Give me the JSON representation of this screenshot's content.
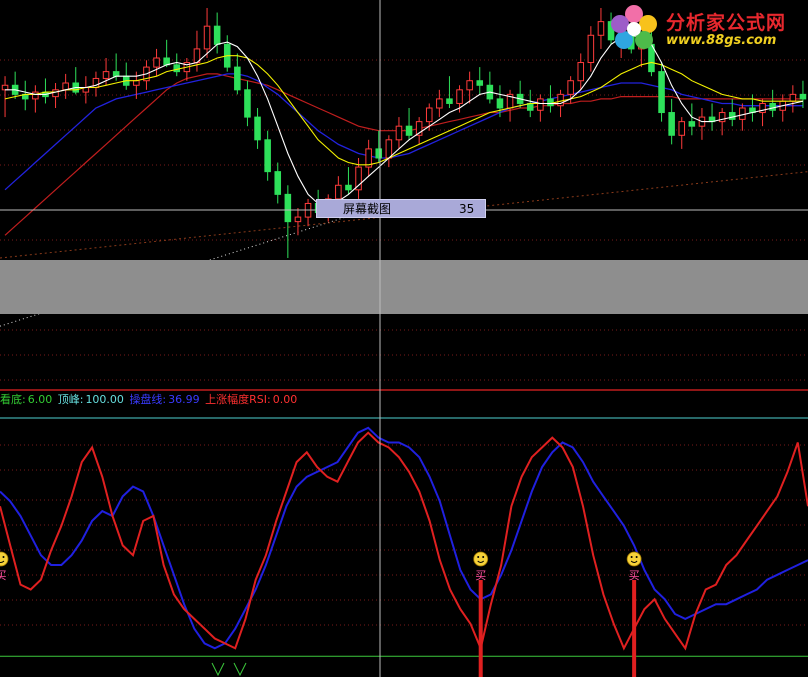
{
  "colors": {
    "background": "#000000",
    "candle_up": "#ff3b3b",
    "candle_down": "#2ee05a",
    "ma_fast": "#ffffff",
    "ma_mid": "#f4f200",
    "ma_slow": "#2222dd",
    "ma_long": "#c01e1e",
    "kdj_red": "#e02020",
    "kdj_blue": "#2020e0",
    "grid": "#7a1a1a",
    "legend_green": "#33cc33",
    "legend_cyan": "#66dddd",
    "legend_blue": "#3a3aff",
    "legend_red": "#ff3030"
  },
  "tooltip": {
    "label": "屏幕截图",
    "value": "35"
  },
  "logo": {
    "name": "分析家公式网",
    "url": "www.88gs.com",
    "icon": "flower-logo-icon"
  },
  "legend": [
    {
      "name": "看底:",
      "value": "6.00",
      "color_key": "legend_green"
    },
    {
      "name": "顶峰:",
      "value": "100.00",
      "color_key": "legend_cyan"
    },
    {
      "name": "操盘线:",
      "value": "36.99",
      "color_key": "legend_blue"
    },
    {
      "name": "上涨幅度RSI:",
      "value": "0.00",
      "color_key": "legend_red"
    }
  ],
  "markers": {
    "buy_label": "买",
    "icon": "smiley-face-icon"
  },
  "chart_data": [
    {
      "type": "candlestick",
      "title": "",
      "candles": [
        [
          64,
          70,
          52,
          66
        ],
        [
          66,
          72,
          60,
          62
        ],
        [
          62,
          68,
          55,
          60
        ],
        [
          60,
          66,
          54,
          63
        ],
        [
          63,
          69,
          58,
          61
        ],
        [
          61,
          67,
          56,
          64
        ],
        [
          64,
          71,
          60,
          67
        ],
        [
          67,
          74,
          62,
          63
        ],
        [
          63,
          70,
          58,
          65
        ],
        [
          65,
          72,
          61,
          69
        ],
        [
          69,
          78,
          66,
          72
        ],
        [
          72,
          80,
          68,
          70
        ],
        [
          70,
          76,
          64,
          66
        ],
        [
          66,
          72,
          60,
          68
        ],
        [
          68,
          77,
          64,
          74
        ],
        [
          74,
          82,
          70,
          78
        ],
        [
          78,
          86,
          74,
          75
        ],
        [
          75,
          80,
          70,
          72
        ],
        [
          72,
          78,
          68,
          76
        ],
        [
          76,
          90,
          72,
          82
        ],
        [
          82,
          100,
          78,
          92
        ],
        [
          92,
          98,
          80,
          84
        ],
        [
          84,
          88,
          72,
          74
        ],
        [
          74,
          80,
          62,
          64
        ],
        [
          64,
          68,
          48,
          52
        ],
        [
          52,
          56,
          38,
          42
        ],
        [
          42,
          46,
          24,
          28
        ],
        [
          28,
          32,
          14,
          18
        ],
        [
          18,
          22,
          -10,
          6
        ],
        [
          6,
          12,
          0,
          8
        ],
        [
          8,
          16,
          4,
          14
        ],
        [
          14,
          20,
          8,
          10
        ],
        [
          10,
          18,
          6,
          16
        ],
        [
          16,
          26,
          12,
          22
        ],
        [
          22,
          30,
          18,
          20
        ],
        [
          20,
          34,
          16,
          30
        ],
        [
          30,
          42,
          26,
          38
        ],
        [
          38,
          46,
          32,
          34
        ],
        [
          34,
          44,
          30,
          42
        ],
        [
          42,
          52,
          38,
          48
        ],
        [
          48,
          56,
          42,
          44
        ],
        [
          44,
          52,
          40,
          50
        ],
        [
          50,
          58,
          46,
          56
        ],
        [
          56,
          64,
          52,
          60
        ],
        [
          60,
          70,
          56,
          58
        ],
        [
          58,
          66,
          54,
          64
        ],
        [
          64,
          72,
          58,
          68
        ],
        [
          68,
          74,
          62,
          66
        ],
        [
          66,
          72,
          58,
          60
        ],
        [
          60,
          66,
          52,
          56
        ],
        [
          56,
          64,
          50,
          62
        ],
        [
          62,
          68,
          56,
          58
        ],
        [
          58,
          64,
          52,
          55
        ],
        [
          55,
          62,
          50,
          60
        ],
        [
          60,
          66,
          54,
          57
        ],
        [
          57,
          64,
          52,
          62
        ],
        [
          62,
          70,
          58,
          68
        ],
        [
          68,
          80,
          64,
          76
        ],
        [
          76,
          92,
          72,
          88
        ],
        [
          88,
          100,
          82,
          94
        ],
        [
          94,
          98,
          84,
          86
        ],
        [
          86,
          92,
          78,
          88
        ],
        [
          88,
          94,
          80,
          82
        ],
        [
          82,
          88,
          74,
          84
        ],
        [
          84,
          90,
          70,
          72
        ],
        [
          72,
          76,
          50,
          54
        ],
        [
          54,
          60,
          40,
          44
        ],
        [
          44,
          52,
          38,
          50
        ],
        [
          50,
          58,
          44,
          48
        ],
        [
          48,
          56,
          42,
          52
        ],
        [
          52,
          58,
          46,
          50
        ],
        [
          50,
          56,
          44,
          54
        ],
        [
          54,
          60,
          48,
          51
        ],
        [
          51,
          58,
          46,
          56
        ],
        [
          56,
          62,
          50,
          54
        ],
        [
          54,
          60,
          48,
          58
        ],
        [
          58,
          64,
          52,
          55
        ],
        [
          55,
          62,
          50,
          59
        ],
        [
          59,
          66,
          54,
          62
        ],
        [
          62,
          68,
          56,
          60
        ]
      ],
      "ma_fast": [
        64,
        64,
        63,
        62,
        62,
        63,
        64,
        65,
        65,
        66,
        68,
        70,
        70,
        70,
        71,
        73,
        75,
        76,
        75,
        76,
        80,
        84,
        85,
        83,
        78,
        70,
        60,
        48,
        36,
        26,
        18,
        14,
        13,
        15,
        18,
        22,
        26,
        30,
        34,
        38,
        42,
        45,
        48,
        51,
        54,
        56,
        59,
        62,
        63,
        62,
        61,
        60,
        59,
        58,
        58,
        58,
        60,
        64,
        70,
        78,
        84,
        87,
        88,
        87,
        84,
        76,
        66,
        58,
        52,
        50,
        50,
        51,
        52,
        53,
        54,
        55,
        56,
        57,
        58,
        59
      ],
      "ma_mid": [
        60,
        61,
        62,
        62,
        63,
        63,
        64,
        64,
        65,
        65,
        66,
        67,
        68,
        68,
        69,
        70,
        72,
        73,
        74,
        75,
        76,
        78,
        79,
        79,
        78,
        75,
        71,
        66,
        60,
        54,
        48,
        42,
        38,
        34,
        32,
        31,
        31,
        32,
        34,
        36,
        38,
        40,
        42,
        44,
        46,
        48,
        50,
        52,
        54,
        55,
        56,
        57,
        58,
        58,
        58,
        59,
        60,
        61,
        63,
        65,
        68,
        71,
        73,
        75,
        76,
        75,
        73,
        71,
        68,
        66,
        64,
        62,
        61,
        60,
        60,
        59,
        59,
        59,
        59,
        59
      ],
      "ma_slow": [
        20,
        24,
        28,
        32,
        36,
        40,
        44,
        48,
        52,
        56,
        58,
        60,
        61,
        62,
        63,
        64,
        65,
        66,
        67,
        68,
        69,
        70,
        71,
        71,
        70,
        68,
        65,
        62,
        58,
        54,
        50,
        46,
        43,
        40,
        38,
        36,
        35,
        34,
        34,
        35,
        36,
        38,
        40,
        42,
        44,
        46,
        48,
        50,
        52,
        54,
        56,
        57,
        58,
        59,
        60,
        61,
        62,
        63,
        64,
        65,
        66,
        67,
        67,
        67,
        66,
        65,
        64,
        62,
        61,
        60,
        59,
        58,
        58,
        57,
        57,
        57,
        57,
        57,
        57,
        57
      ],
      "ma_long": [
        0,
        4,
        8,
        12,
        16,
        20,
        24,
        28,
        32,
        36,
        40,
        44,
        48,
        52,
        56,
        60,
        64,
        67,
        69,
        70,
        71,
        71,
        70,
        69,
        68,
        67,
        66,
        64,
        62,
        60,
        58,
        56,
        54,
        52,
        50,
        48,
        47,
        46,
        46,
        46,
        46,
        47,
        48,
        49,
        50,
        51,
        52,
        53,
        54,
        54,
        55,
        56,
        56,
        57,
        57,
        58,
        58,
        59,
        59,
        60,
        60,
        61,
        61,
        61,
        61,
        61,
        61,
        60,
        60,
        60,
        60,
        60,
        60,
        60,
        60,
        60,
        60,
        60,
        60,
        60
      ],
      "dotted_trend": [
        -40,
        10
      ],
      "long_trend": [
        -20,
        8
      ],
      "crosshair_price": 0
    },
    {
      "type": "line",
      "title": "",
      "ylim": [
        0,
        100
      ],
      "ref_lines": [
        6,
        100
      ],
      "series": [
        {
          "name": "操盘线",
          "color_key": "kdj_blue",
          "values": [
            70,
            66,
            60,
            52,
            44,
            40,
            40,
            44,
            50,
            58,
            62,
            60,
            68,
            72,
            70,
            60,
            48,
            36,
            24,
            14,
            8,
            6,
            8,
            14,
            22,
            30,
            40,
            52,
            64,
            72,
            76,
            78,
            80,
            82,
            88,
            94,
            96,
            92,
            90,
            90,
            88,
            84,
            76,
            66,
            52,
            38,
            30,
            26,
            28,
            36,
            46,
            58,
            70,
            80,
            86,
            90,
            88,
            82,
            74,
            68,
            62,
            56,
            48,
            38,
            30,
            26,
            20,
            18,
            20,
            22,
            24,
            24,
            26,
            28,
            30,
            34,
            36,
            38,
            40,
            42
          ]
        },
        {
          "name": "上涨幅度RSI",
          "color_key": "kdj_red",
          "values": [
            64,
            48,
            32,
            30,
            34,
            46,
            56,
            68,
            82,
            88,
            76,
            60,
            48,
            44,
            58,
            60,
            40,
            28,
            22,
            18,
            14,
            10,
            8,
            6,
            18,
            34,
            44,
            58,
            70,
            82,
            86,
            80,
            76,
            74,
            82,
            90,
            94,
            90,
            88,
            84,
            78,
            70,
            58,
            42,
            30,
            22,
            16,
            6,
            24,
            40,
            64,
            76,
            84,
            88,
            92,
            88,
            80,
            64,
            44,
            28,
            16,
            6,
            14,
            22,
            26,
            18,
            12,
            6,
            20,
            30,
            32,
            40,
            44,
            50,
            56,
            62,
            68,
            78,
            90,
            64
          ]
        }
      ],
      "buy_signals": [
        0,
        47,
        62
      ]
    }
  ]
}
